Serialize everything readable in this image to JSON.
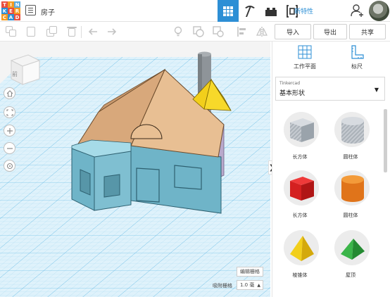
{
  "app": {
    "logo_letters": [
      "T",
      "I",
      "N",
      "K",
      "E",
      "R",
      "C",
      "A",
      "D"
    ],
    "logo_colors": [
      "#e94e3c",
      "#f39b22",
      "#5aa9dd",
      "#2d8fd5",
      "#e94e3c",
      "#f39b22",
      "#f39b22",
      "#2d8fd5",
      "#e94e3c"
    ],
    "title": "房子"
  },
  "topbar": {
    "new_features": "新特性",
    "view_buttons": [
      "grid-view-icon",
      "pickaxe-icon",
      "bricks-icon",
      "code-blocks-icon"
    ],
    "accent": "#2d8fd5"
  },
  "toolbar": {
    "import": "导入",
    "export": "导出",
    "share": "共享"
  },
  "viewcube": {
    "face_label": "前"
  },
  "snap": {
    "edit_grid": "编辑栅格",
    "snap_label": "吸附栅格",
    "snap_value": "1.0 毫"
  },
  "panel": {
    "workplane": "工作平面",
    "ruler": "标尺",
    "library_brand": "Tinkercad",
    "library_name": "基本形状",
    "shapes": [
      {
        "label": "长方体",
        "icon": "striped-box-icon"
      },
      {
        "label": "圆柱体",
        "icon": "striped-cylinder-icon"
      },
      {
        "label": "长方体",
        "icon": "red-box-icon"
      },
      {
        "label": "圆柱体",
        "icon": "orange-cylinder-icon"
      },
      {
        "label": "棱锥体",
        "icon": "yellow-pyramid-icon"
      },
      {
        "label": "屋顶",
        "icon": "green-roof-icon"
      }
    ]
  },
  "colors": {
    "house_walls": "#6fb4c8",
    "house_roof": "#e0b58d",
    "gable": "#b9a9cc",
    "pyramid": "#f2cf1b",
    "chimney": "#8e9499"
  }
}
